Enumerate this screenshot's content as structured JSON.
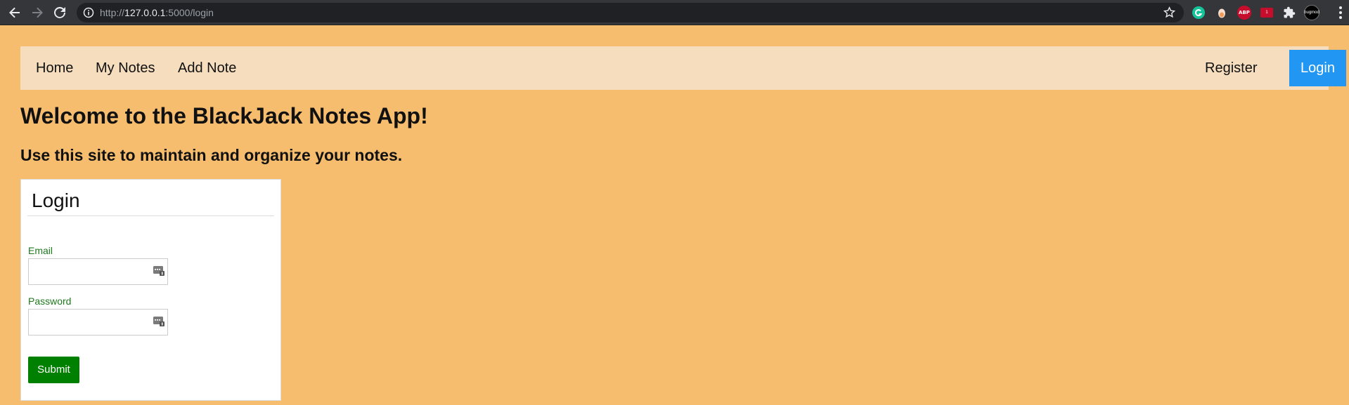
{
  "browser": {
    "url_scheme": "http://",
    "url_host": "127.0.0.1",
    "url_path": ":5000/login",
    "icons": {
      "back": "back-arrow-icon",
      "forward": "forward-arrow-icon",
      "reload": "reload-icon",
      "info": "site-info-icon",
      "bookmark": "star-icon",
      "grammarly": "grammarly-icon",
      "extension2": "extension-icon",
      "abp": "ABP",
      "extension4": "extension-badge-icon",
      "extension4_badge": "1",
      "puzzle": "puzzle-icon",
      "bugmod": "bugmod",
      "menu": "menu-dots-icon"
    }
  },
  "navbar": {
    "home": "Home",
    "my_notes": "My Notes",
    "add_note": "Add Note",
    "register": "Register",
    "login": "Login"
  },
  "page": {
    "title": "Welcome to the BlackJack Notes App!",
    "subtitle": "Use this site to maintain and organize your notes."
  },
  "login_form": {
    "title": "Login",
    "email_label": "Email",
    "email_value": "",
    "password_label": "Password",
    "password_value": "",
    "submit_label": "Submit"
  },
  "colors": {
    "page_background": "#f7bd6e",
    "navbar_background": "#f5ddbd",
    "login_button": "#2196f3",
    "submit_button": "#008000",
    "label_color": "#1d7a1d"
  }
}
